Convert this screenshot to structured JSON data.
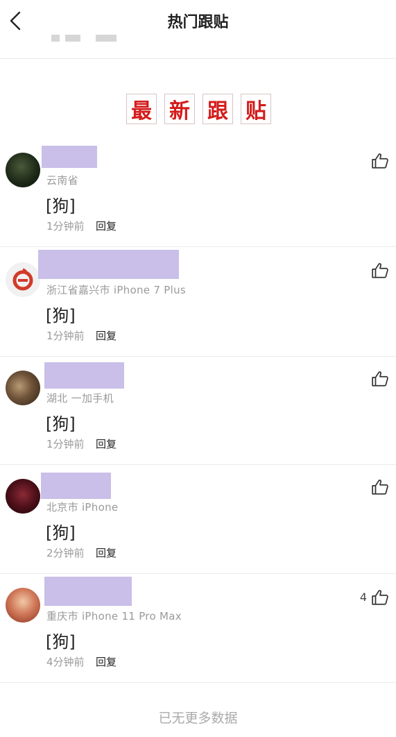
{
  "header": {
    "title": "热门跟贴"
  },
  "section": {
    "chars": [
      "最",
      "新",
      "跟",
      "贴"
    ]
  },
  "comments": [
    {
      "meta": "云南省",
      "text": "[狗]",
      "time": "1分钟前",
      "reply": "回复",
      "likes": ""
    },
    {
      "meta": "浙江省嘉兴市  iPhone 7 Plus",
      "text": "[狗]",
      "time": "1分钟前",
      "reply": "回复",
      "likes": ""
    },
    {
      "meta": "湖北  一加手机",
      "text": "[狗]",
      "time": "1分钟前",
      "reply": "回复",
      "likes": ""
    },
    {
      "meta": "北京市  iPhone",
      "text": "[狗]",
      "time": "2分钟前",
      "reply": "回复",
      "likes": ""
    },
    {
      "meta": "重庆市  iPhone 11 Pro Max",
      "text": "[狗]",
      "time": "4分钟前",
      "reply": "回复",
      "likes": "4"
    }
  ],
  "footer": {
    "text": "已无更多数据"
  },
  "icons": {
    "back": "chevron-left-icon",
    "like": "thumbs-up-icon"
  },
  "colors": {
    "accent": "#d41c1c",
    "name_redaction": "#c9bfe8",
    "muted": "#9a9a9a"
  }
}
